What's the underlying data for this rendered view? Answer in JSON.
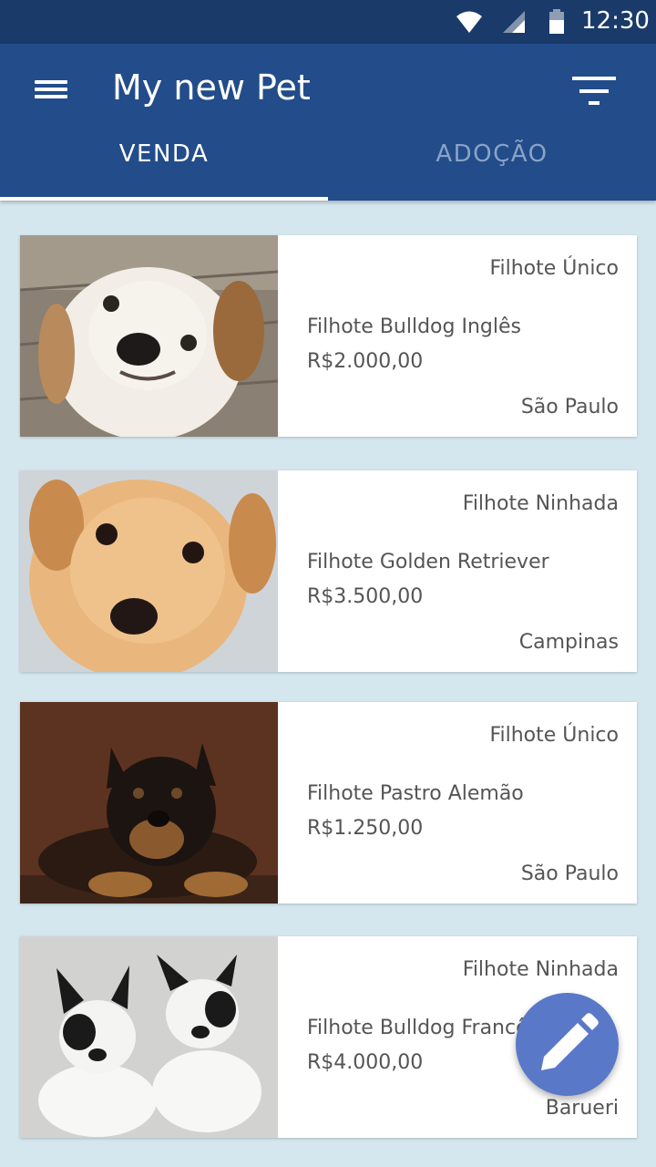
{
  "status_bar": {
    "time": "12:30"
  },
  "app_bar": {
    "title": "My new Pet"
  },
  "tabs": [
    {
      "label": "VENDA",
      "selected": true
    },
    {
      "label": "ADOÇÃO",
      "selected": false
    }
  ],
  "listings": [
    {
      "type": "Filhote Único",
      "name": "Filhote Bulldog Inglês",
      "price": "R$2.000,00",
      "city": "São Paulo"
    },
    {
      "type": "Filhote Ninhada",
      "name": "Filhote Golden Retriever",
      "price": "R$3.500,00",
      "city": "Campinas"
    },
    {
      "type": "Filhote Único",
      "name": "Filhote Pastro Alemão",
      "price": "R$1.250,00",
      "city": "São Paulo"
    },
    {
      "type": "Filhote Ninhada",
      "name": "Filhote Bulldog Francês",
      "price": "R$4.000,00",
      "city": "Barueri"
    }
  ],
  "colors": {
    "app_bar": "#224c8a",
    "status_bar": "#1a3a6a",
    "background": "#d4e6ee",
    "fab": "#5a78c8"
  },
  "icons": {
    "menu": "menu-icon",
    "filter": "filter-icon",
    "fab": "pencil-icon"
  }
}
